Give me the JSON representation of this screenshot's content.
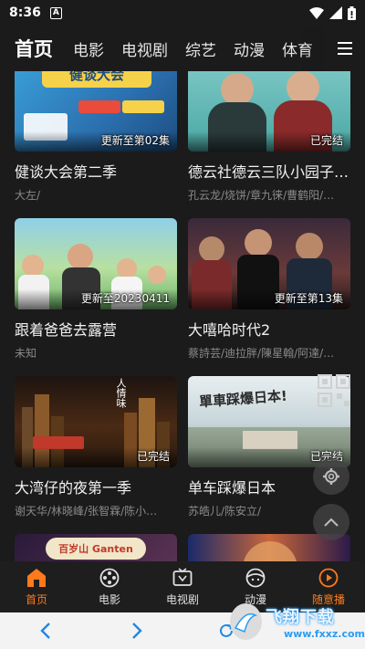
{
  "status": {
    "time": "8:36",
    "notif_letter": "A"
  },
  "nav": {
    "tabs": [
      "首页",
      "电影",
      "电视剧",
      "综艺",
      "动漫",
      "体育"
    ],
    "active": 0
  },
  "cards": [
    {
      "title": "健谈大会第二季",
      "sub": "大左/",
      "badge": "更新至第02集",
      "thumb_text": "健谈大会"
    },
    {
      "title": "德云社德云三队小园子…",
      "sub": "孔云龙/烧饼/章九徕/曹鹤阳/…",
      "badge": "已完结",
      "thumb_text": ""
    },
    {
      "title": "跟着爸爸去露营",
      "sub": "未知",
      "badge": "更新至20230411",
      "thumb_text": ""
    },
    {
      "title": "大嘻哈时代2",
      "sub": "蔡詩芸/迪拉胖/陳星翰/阿達/…",
      "badge": "更新至第13集",
      "thumb_text": ""
    },
    {
      "title": "大湾仔的夜第一季",
      "sub": "谢天华/林晓峰/张智霖/陈小…",
      "badge": "已完结",
      "thumb_text": "人情味"
    },
    {
      "title": "单车踩爆日本",
      "sub": "苏皓儿/陈安立/",
      "badge": "已完结",
      "thumb_text": "單車踩爆日本!"
    },
    {
      "title": "",
      "sub": "",
      "badge": "",
      "thumb_text": "百岁山 Ganten"
    },
    {
      "title": "",
      "sub": "",
      "badge": "",
      "thumb_text": ""
    }
  ],
  "bottom_nav": {
    "items": [
      {
        "label": "首页",
        "icon": "home-icon"
      },
      {
        "label": "电影",
        "icon": "film-reel-icon"
      },
      {
        "label": "电视剧",
        "icon": "tv-icon"
      },
      {
        "label": "动漫",
        "icon": "anime-icon"
      },
      {
        "label": "随意播",
        "icon": "play-circle-icon"
      }
    ],
    "active": 0
  },
  "watermark": {
    "main": "飞翔下载",
    "url": "www.fxxz.com"
  },
  "colors": {
    "accent": "#ff7a1a",
    "background": "#1b1b1b"
  }
}
